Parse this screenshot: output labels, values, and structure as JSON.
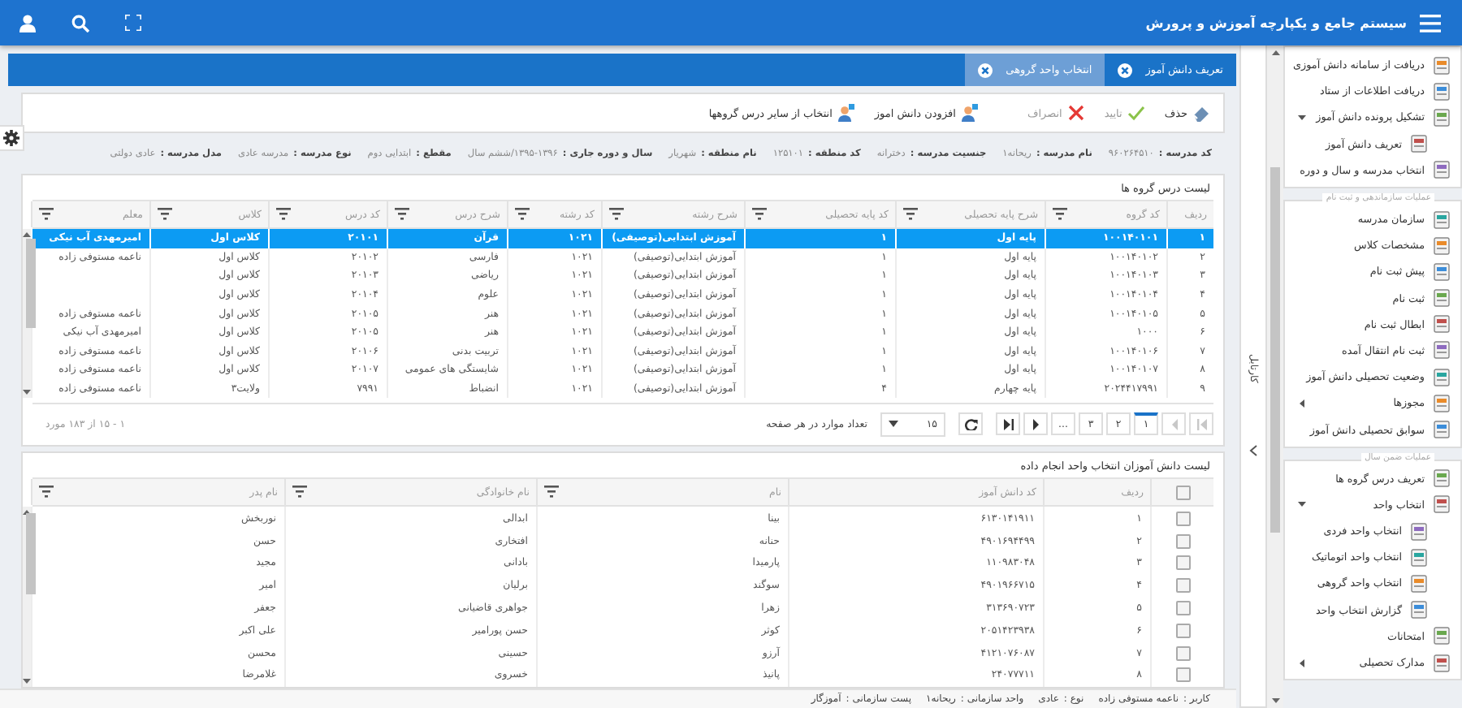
{
  "header": {
    "title": "سیستم جامع و یکپارچه آموزش و پرورش"
  },
  "tabs": [
    {
      "label": "تعریف دانش آموز",
      "selected": false
    },
    {
      "label": "انتخاب واحد گروهی",
      "selected": true
    }
  ],
  "toolbar": [
    {
      "label": "حذف",
      "kind": "delete",
      "disabled": false
    },
    {
      "label": "تایید",
      "kind": "confirm",
      "disabled": true
    },
    {
      "label": "انصراف",
      "kind": "cancel",
      "disabled": true
    },
    {
      "label": "افزودن دانش اموز",
      "kind": "add",
      "disabled": false
    },
    {
      "label": "انتخاب از سایر درس گروهها",
      "kind": "pick",
      "disabled": false
    }
  ],
  "school_info": [
    {
      "label": "کد مدرسه :",
      "value": "۹۶۰۲۶۴۵۱۰"
    },
    {
      "label": "نام مدرسه :",
      "value": "ریحانه۱"
    },
    {
      "label": "جنسیت مدرسه :",
      "value": "دخترانه"
    },
    {
      "label": "کد منطقه :",
      "value": "۱۲۵۱۰۱"
    },
    {
      "label": "نام منطقه :",
      "value": "شهریار"
    },
    {
      "label": "سال و دوره جاری :",
      "value": "۱۳۹۵-۱۳۹۶/ششم سال"
    },
    {
      "label": "مقطع :",
      "value": "ابتدایی دوم"
    },
    {
      "label": "نوع مدرسه :",
      "value": "مدرسه عادی"
    },
    {
      "label": "مدل مدرسه :",
      "value": "عادی دولتی"
    }
  ],
  "lessons_grid": {
    "title": "لیست درس گروه ها",
    "columns": [
      {
        "label": "ردیف",
        "filterable": false
      },
      {
        "label": "کد گروه",
        "filterable": true
      },
      {
        "label": "شرح پایه تحصیلی",
        "filterable": true
      },
      {
        "label": "کد پایه تحصیلی",
        "filterable": true
      },
      {
        "label": "شرح رشته",
        "filterable": true
      },
      {
        "label": "کد رشته",
        "filterable": true
      },
      {
        "label": "شرح درس",
        "filterable": true
      },
      {
        "label": "کد درس",
        "filterable": true
      },
      {
        "label": "کلاس",
        "filterable": true
      },
      {
        "label": "معلم",
        "filterable": true
      }
    ],
    "rows": [
      {
        "selected": true,
        "cells": [
          "۱",
          "۱۰۰۱۴۰۱۰۱",
          "پایه اول",
          "۱",
          "آموزش ابتدایی(توصیفی)",
          "۱۰۲۱",
          "قرآن",
          "۲۰۱۰۱",
          "کلاس اول",
          "امیرمهدی آب نیکی"
        ]
      },
      {
        "selected": false,
        "cells": [
          "۲",
          "۱۰۰۱۴۰۱۰۲",
          "پایه اول",
          "۱",
          "آموزش ابتدایی(توصیفی)",
          "۱۰۲۱",
          "فارسی",
          "۲۰۱۰۲",
          "کلاس اول",
          "ناعمه مستوفی زاده"
        ]
      },
      {
        "selected": false,
        "cells": [
          "۳",
          "۱۰۰۱۴۰۱۰۳",
          "پایه اول",
          "۱",
          "آموزش ابتدایی(توصیفی)",
          "۱۰۲۱",
          "ریاضی",
          "۲۰۱۰۳",
          "کلاس اول",
          null
        ]
      },
      {
        "selected": false,
        "cells": [
          "۴",
          "۱۰۰۱۴۰۱۰۴",
          "پایه اول",
          "۱",
          "آموزش ابتدایی(توصیفی)",
          "۱۰۲۱",
          "علوم",
          "۲۰۱۰۴",
          "کلاس اول",
          null
        ]
      },
      {
        "selected": false,
        "cells": [
          "۵",
          "۱۰۰۱۴۰۱۰۵",
          "پایه اول",
          "۱",
          "آموزش ابتدایی(توصیفی)",
          "۱۰۲۱",
          "هنر",
          "۲۰۱۰۵",
          "کلاس اول",
          "ناعمه مستوفی زاده"
        ]
      },
      {
        "selected": false,
        "cells": [
          "۶",
          "۱۰۰۰",
          "پایه اول",
          "۱",
          "آموزش ابتدایی(توصیفی)",
          "۱۰۲۱",
          "هنر",
          "۲۰۱۰۵",
          "کلاس اول",
          "امیرمهدی آب نیکی"
        ]
      },
      {
        "selected": false,
        "cells": [
          "۷",
          "۱۰۰۱۴۰۱۰۶",
          "پایه اول",
          "۱",
          "آموزش ابتدایی(توصیفی)",
          "۱۰۲۱",
          "تربیت بدنی",
          "۲۰۱۰۶",
          "کلاس اول",
          "ناعمه مستوفی زاده"
        ]
      },
      {
        "selected": false,
        "cells": [
          "۸",
          "۱۰۰۱۴۰۱۰۷",
          "پایه اول",
          "۱",
          "آموزش ابتدایی(توصیفی)",
          "۱۰۲۱",
          "شایستگی های عمومی",
          "۲۰۱۰۷",
          "کلاس اول",
          "ناعمه مستوفی زاده"
        ]
      },
      {
        "selected": false,
        "cells": [
          "۹",
          "۲۰۲۴۴۱۷۹۹۱",
          "پایه چهارم",
          "۴",
          "آموزش ابتدایی(توصیفی)",
          "۱۰۲۱",
          "انضباط",
          "۷۹۹۱",
          "ولایت۳",
          "ناعمه مستوفی زاده"
        ]
      }
    ],
    "pager": {
      "buttons": [
        {
          "kind": "first",
          "disabled": true
        },
        {
          "kind": "prev",
          "disabled": true
        },
        {
          "kind": "page",
          "label": "۱",
          "selected": true
        },
        {
          "kind": "page",
          "label": "۲",
          "selected": false
        },
        {
          "kind": "page",
          "label": "۳",
          "selected": false
        },
        {
          "kind": "page",
          "label": "...",
          "selected": false
        },
        {
          "kind": "next",
          "disabled": false
        },
        {
          "kind": "last",
          "disabled": false
        },
        {
          "kind": "refresh",
          "disabled": false
        }
      ],
      "page_size": "۱۵",
      "page_size_label": "تعداد موارد در هر صفحه",
      "summary": "۱ - ۱۵ از ۱۸۳ مورد"
    }
  },
  "students_grid": {
    "title": "لیست دانش آموزان انتخاب واحد انجام داده",
    "header_checked": false,
    "columns": [
      {
        "label": "ردیف",
        "filterable": false
      },
      {
        "label": "کد دانش آموز",
        "filterable": false
      },
      {
        "label": "نام",
        "filterable": true
      },
      {
        "label": "نام خانوادگی",
        "filterable": true
      },
      {
        "label": "نام پدر",
        "filterable": true
      }
    ],
    "rows": [
      {
        "checked": false,
        "cells": [
          "۱",
          "۶۱۳۰۱۴۱۹۱۱",
          "بینا",
          "ابدالی",
          "نوربخش"
        ]
      },
      {
        "checked": false,
        "cells": [
          "۲",
          "۴۹۰۱۶۹۴۴۹۹",
          "حنانه",
          "افتخاری",
          "حسن"
        ]
      },
      {
        "checked": false,
        "cells": [
          "۳",
          "۱۱۰۹۸۳۰۴۸",
          "پارمیدا",
          "بادانی",
          "مجید"
        ]
      },
      {
        "checked": false,
        "cells": [
          "۴",
          "۴۹۰۱۹۶۶۷۱۵",
          "سوگند",
          "برلیان",
          "امیر"
        ]
      },
      {
        "checked": false,
        "cells": [
          "۵",
          "۳۱۳۶۹۰۷۲۳",
          "زهرا",
          "جواهری قاضیانی",
          "جعفر"
        ]
      },
      {
        "checked": false,
        "cells": [
          "۶",
          "۲۰۵۱۴۲۳۹۳۸",
          "کوثر",
          "حسن پورامیر",
          "علی اکبر"
        ]
      },
      {
        "checked": false,
        "cells": [
          "۷",
          "۴۱۲۱۰۷۶۰۸۷",
          "آرزو",
          "حسینی",
          "محسن"
        ]
      },
      {
        "checked": false,
        "cells": [
          "۸",
          "۲۴۰۷۷۷۱۱",
          "پانیذ",
          "خسروی",
          "غلامرضا"
        ]
      }
    ]
  },
  "side_panel": {
    "label": "کارتابل"
  },
  "sidebar": {
    "sections": [
      {
        "items": [
          {
            "label": "دریافت از سامانه دانش آموزی"
          },
          {
            "label": "دریافت اطلاعات از ستاد"
          },
          {
            "label": "تشکیل پرونده دانش آموز",
            "expanded": true,
            "children": [
              {
                "label": "تعریف دانش آموز"
              }
            ]
          },
          {
            "label": "انتخاب مدرسه و سال و دوره"
          }
        ]
      },
      {
        "title": "عملیات سازماندهی و ثبت نام",
        "items": [
          {
            "label": "سازمان مدرسه"
          },
          {
            "label": "مشخصات کلاس"
          },
          {
            "label": "پیش ثبت نام"
          },
          {
            "label": "ثبت نام"
          },
          {
            "label": "ابطال ثبت نام"
          },
          {
            "label": "ثبت نام انتقال آمده"
          },
          {
            "label": "وضعیت تحصیلی دانش آموز"
          },
          {
            "label": "مجوزها",
            "expanded": false
          },
          {
            "label": "سوابق تحصیلی دانش آموز"
          }
        ]
      },
      {
        "title": "عملیات ضمن سال",
        "items": [
          {
            "label": "تعریف درس گروه ها"
          },
          {
            "label": "انتخاب واحد",
            "expanded": true,
            "children": [
              {
                "label": "انتخاب واحد فردی"
              },
              {
                "label": "انتخاب واحد اتوماتیک"
              },
              {
                "label": "انتخاب واحد گروهی"
              },
              {
                "label": "گزارش انتخاب واحد"
              }
            ]
          },
          {
            "label": "امتحانات"
          },
          {
            "label": "مدارک تحصیلی",
            "expanded": false
          }
        ]
      }
    ]
  },
  "status_bar": [
    {
      "label": "کاربر :",
      "value": "ناعمه مستوفی زاده"
    },
    {
      "label": "نوع :",
      "value": "عادی"
    },
    {
      "label": "واحد سازمانی :",
      "value": "ریحانه۱"
    },
    {
      "label": "پست سازمانی :",
      "value": "آموزگار"
    }
  ]
}
